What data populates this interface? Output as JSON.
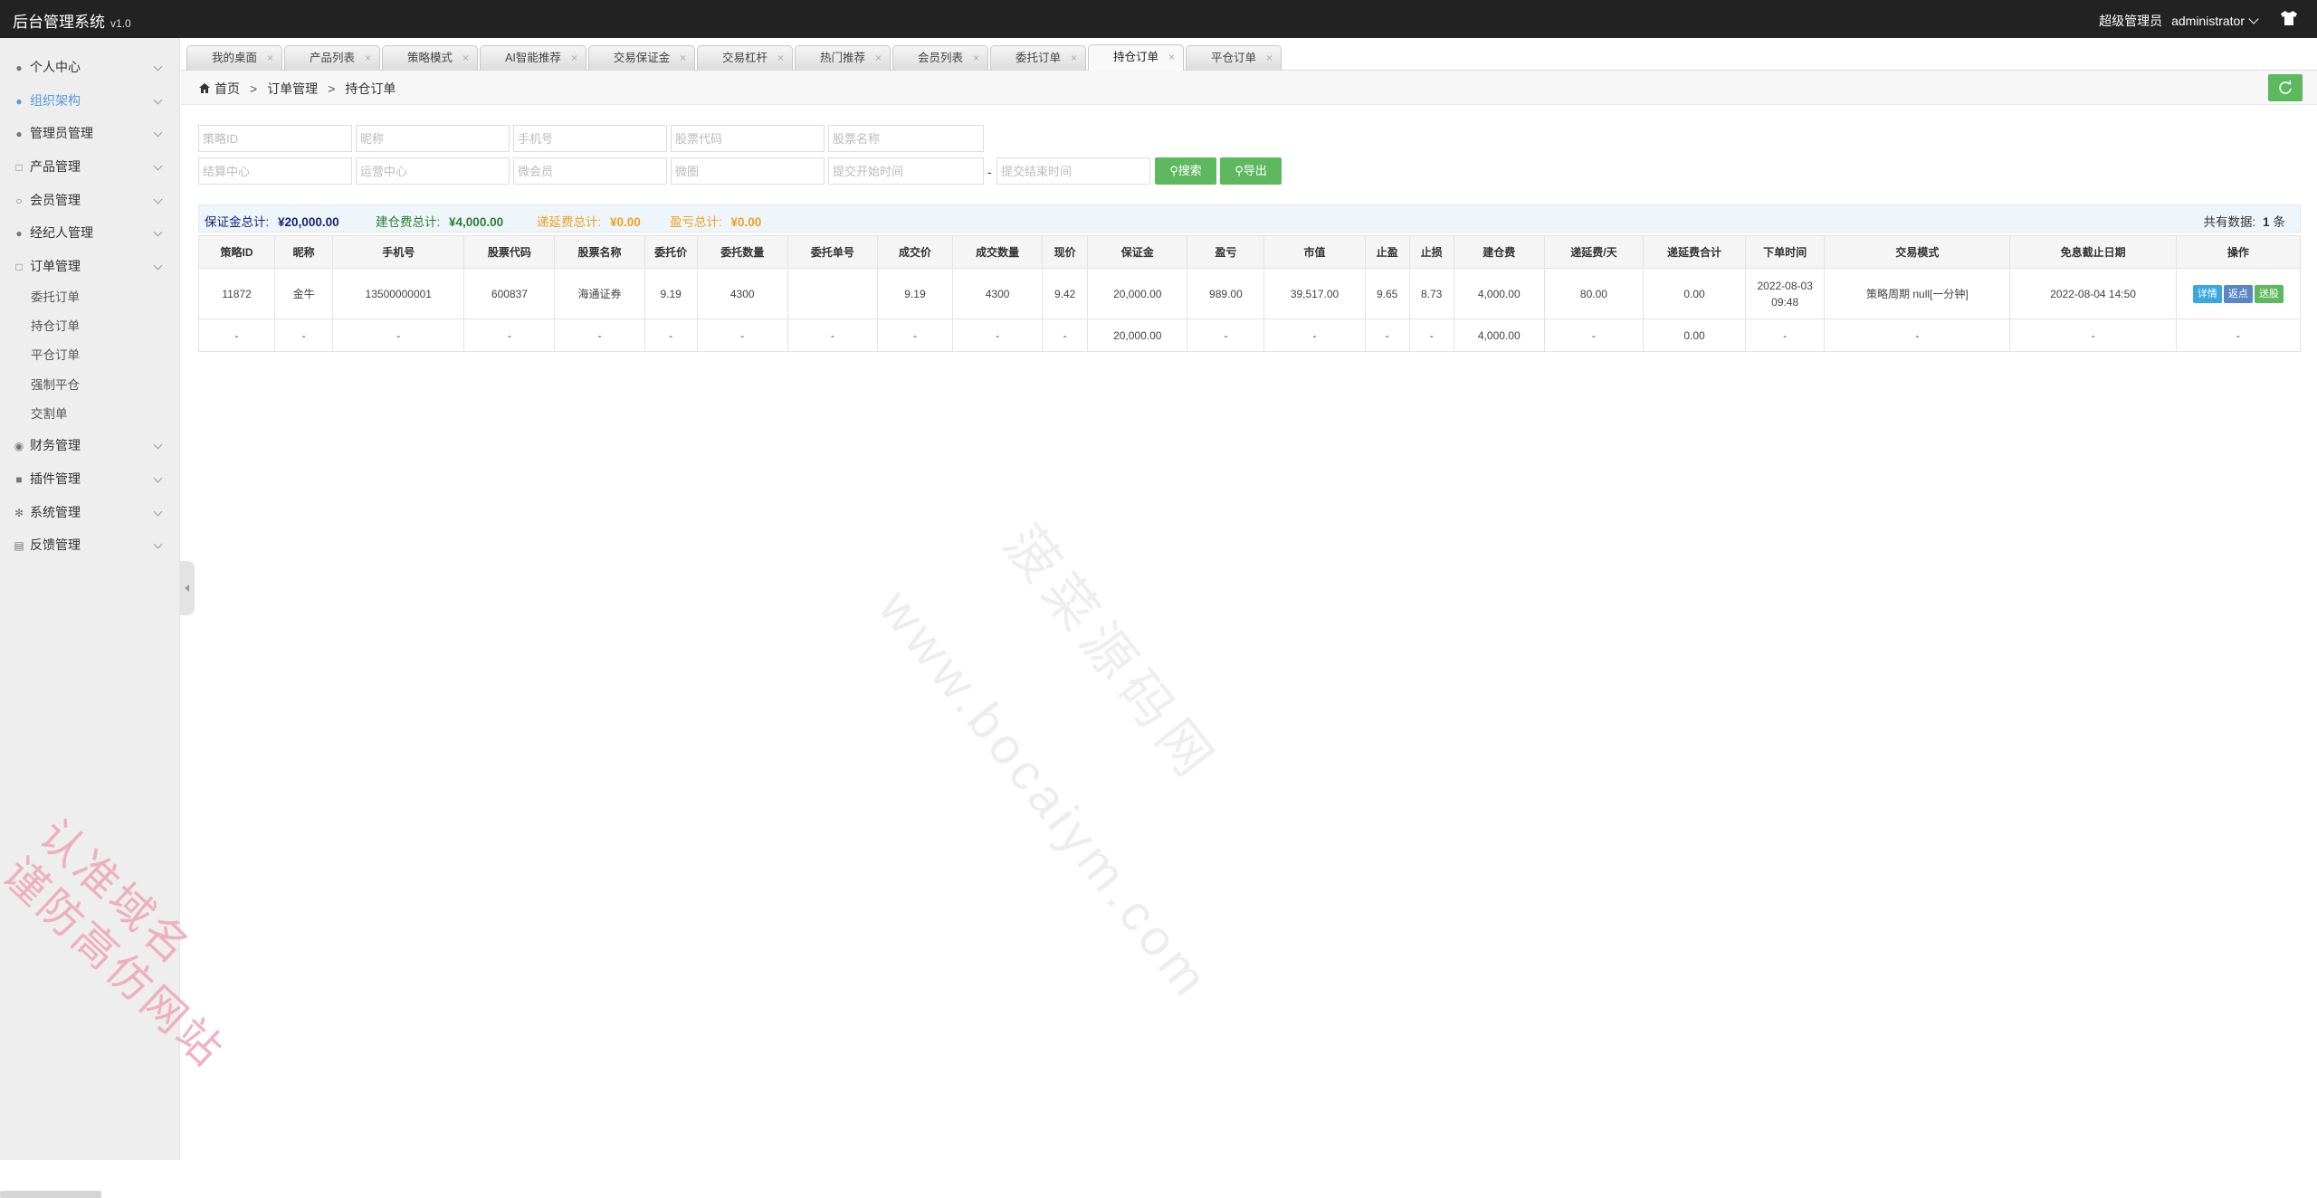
{
  "app": {
    "title": "后台管理系统",
    "version": "v1.0",
    "role": "超级管理员",
    "user": "administrator"
  },
  "sidebar": {
    "items": [
      {
        "label": "个人中心",
        "icon": "user-icon"
      },
      {
        "label": "组织架构",
        "icon": "org-icon",
        "active": true
      },
      {
        "label": "管理员管理",
        "icon": "admin-icon"
      },
      {
        "label": "产品管理",
        "icon": "product-icon"
      },
      {
        "label": "会员管理",
        "icon": "member-icon"
      },
      {
        "label": "经纪人管理",
        "icon": "broker-icon"
      },
      {
        "label": "订单管理",
        "icon": "order-icon"
      }
    ],
    "sub_items": [
      "委托订单",
      "持仓订单",
      "平仓订单",
      "强制平仓",
      "交割单"
    ],
    "items_after": [
      {
        "label": "财务管理",
        "icon": "finance-icon"
      },
      {
        "label": "插件管理",
        "icon": "plugin-icon"
      },
      {
        "label": "系统管理",
        "icon": "settings-icon"
      },
      {
        "label": "反馈管理",
        "icon": "feedback-icon"
      }
    ]
  },
  "tabs": [
    "我的桌面",
    "产品列表",
    "策略模式",
    "AI智能推荐",
    "交易保证金",
    "交易杠杆",
    "热门推荐",
    "会员列表",
    "委托订单",
    "持仓订单",
    "平仓订单"
  ],
  "active_tab": "持仓订单",
  "breadcrumb": {
    "home": "首页",
    "level1": "订单管理",
    "level2": "持仓订单"
  },
  "filters": {
    "row1": [
      "策略ID",
      "昵称",
      "手机号",
      "股票代码",
      "股票名称"
    ],
    "row2": [
      "结算中心",
      "运营中心",
      "微会员",
      "微圈",
      "提交开始时间"
    ],
    "end_time": "提交结束时间",
    "dash": "-",
    "search_btn": "搜索",
    "export_btn": "导出"
  },
  "summary": {
    "margin_label": "保证金总计:",
    "margin_value": "¥20,000.00",
    "open_fee_label": "建仓费总计:",
    "open_fee_value": "¥4,000.00",
    "defer_fee_label": "递延费总计:",
    "defer_fee_value": "¥0.00",
    "pnl_label": "盈亏总计:",
    "pnl_value": "¥0.00",
    "count_label": "共有数据:",
    "count_value": "1",
    "count_unit": "条"
  },
  "table": {
    "headers": [
      "策略ID",
      "昵称",
      "手机号",
      "股票代码",
      "股票名称",
      "委托价",
      "委托数量",
      "委托单号",
      "成交价",
      "成交数量",
      "现价",
      "保证金",
      "盈亏",
      "市值",
      "止盈",
      "止损",
      "建仓费",
      "递延费/天",
      "递延费合计",
      "下单时间",
      "交易模式",
      "免息截止日期",
      "操作"
    ],
    "row": {
      "id": "11872",
      "nickname": "金牛",
      "phone": "13500000001",
      "code": "600837",
      "name": "海通证券",
      "order_price": "9.19",
      "order_qty": "4300",
      "order_no": "",
      "deal_price": "9.19",
      "deal_qty": "4300",
      "current": "9.42",
      "margin": "20,000.00",
      "pnl": "989.00",
      "market_value": "39,517.00",
      "take_profit": "9.65",
      "stop_loss": "8.73",
      "open_fee": "4,000.00",
      "defer_day": "80.00",
      "defer_total": "0.00",
      "order_date": "2022-08-03",
      "order_time": "09:48",
      "mode": "策略周期 null[一分钟]",
      "free_until": "2022-08-04 14:50",
      "actions": [
        "详情",
        "返点",
        "送股"
      ]
    },
    "total_row": {
      "dash": "-",
      "margin": "20,000.00",
      "open_fee": "4,000.00",
      "defer_total": "0.00"
    }
  },
  "watermarks": {
    "w1": "www.bocaiym.com",
    "w2": "菠菜源码网",
    "w3a": "认准域名",
    "w3b": "谨防高仿网站"
  },
  "colors": {
    "topbar": "#222222",
    "green": "#5eb95e",
    "blue_link": "#5a98de",
    "loss": "#d43f3a",
    "margin_sum": "#1a237e",
    "fee_sum": "#2e7d32",
    "defer_sum": "#f0a020"
  }
}
